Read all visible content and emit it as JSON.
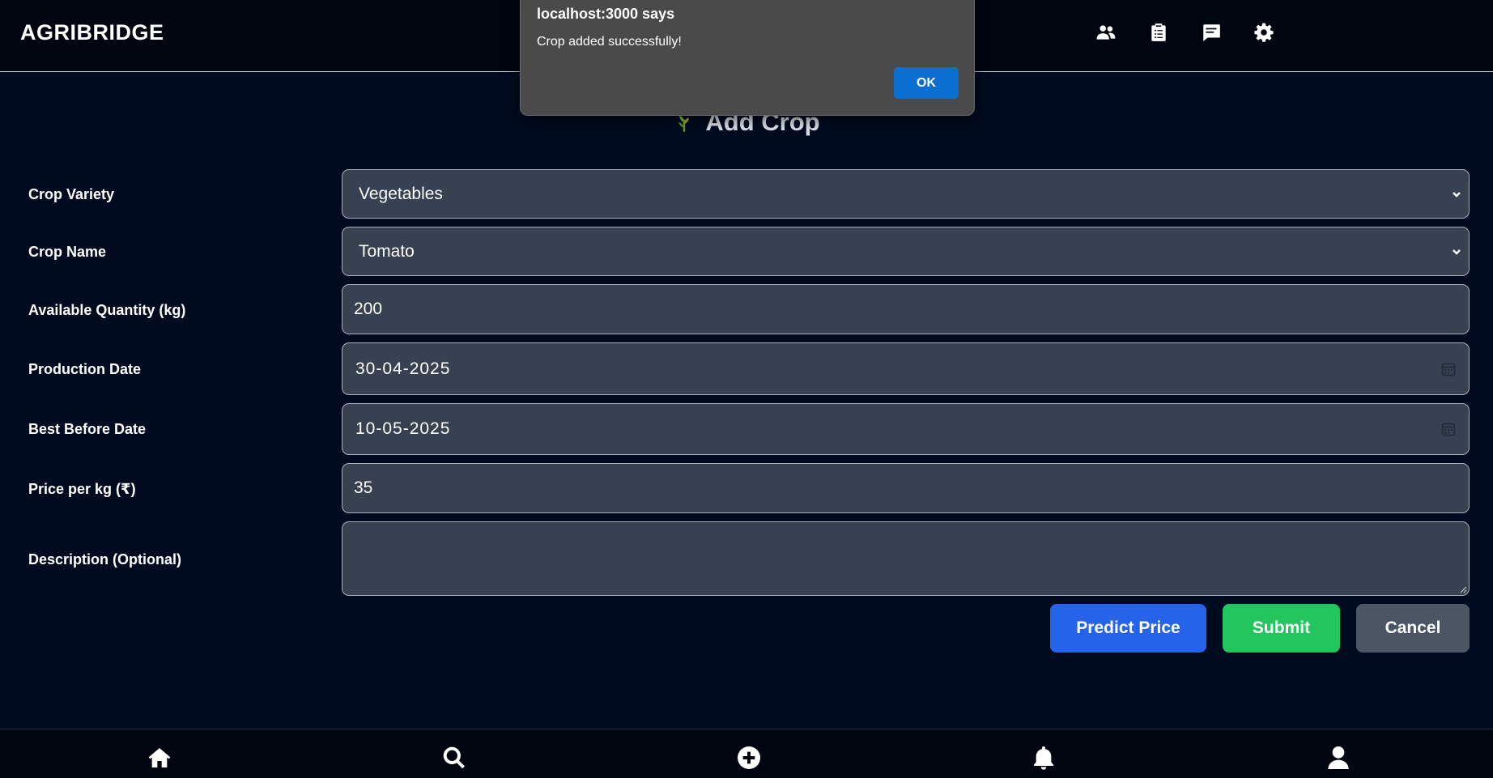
{
  "app": {
    "brand": "AGRIBRIDGE"
  },
  "header": {
    "icons": [
      "users-icon",
      "clipboard-icon",
      "message-icon",
      "gear-icon"
    ]
  },
  "page": {
    "title": "Add Crop",
    "title_icon": "crop-icon"
  },
  "form": {
    "crop_variety": {
      "label": "Crop Variety",
      "value": "Vegetables"
    },
    "crop_name": {
      "label": "Crop Name",
      "value": "Tomato"
    },
    "quantity": {
      "label": "Available Quantity (kg)",
      "value": "200"
    },
    "production_date": {
      "label": "Production Date",
      "value": "30-04-2025"
    },
    "best_before": {
      "label": "Best Before Date",
      "value": "10-05-2025"
    },
    "price": {
      "label": "Price per kg (₹)",
      "value": "35"
    },
    "description": {
      "label": "Description (Optional)",
      "value": ""
    }
  },
  "actions": {
    "predict_label": "Predict Price",
    "submit_label": "Submit",
    "cancel_label": "Cancel"
  },
  "bottom_nav": {
    "icons": [
      "home-icon",
      "search-icon",
      "add-circle-icon",
      "bell-icon",
      "user-icon"
    ]
  },
  "dialog": {
    "title": "localhost:3000 says",
    "message": "Crop added successfully!",
    "ok_label": "OK"
  },
  "colors": {
    "background": "#000b1f",
    "field": "#374151",
    "predict": "#2563eb",
    "submit": "#22c55e",
    "cancel": "#4b5563",
    "dialog_ok": "#0a6fd1"
  }
}
